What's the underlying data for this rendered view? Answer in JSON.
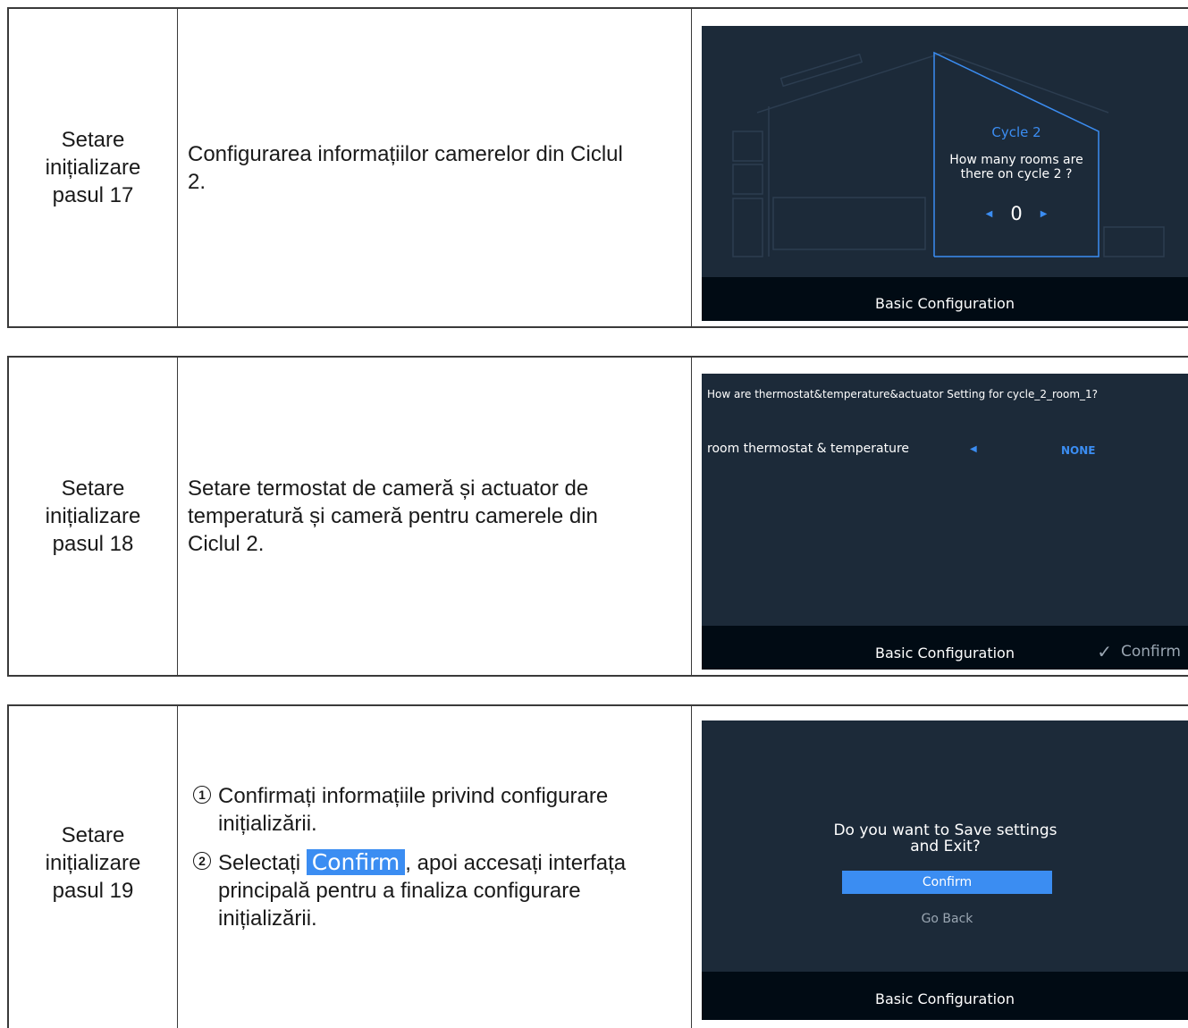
{
  "steps": [
    {
      "step_label": [
        "Setare",
        "inițializare",
        "pasul 17"
      ],
      "description": "Configurarea informațiilor camerelor din Ciclul 2.",
      "screen": {
        "cycle_title": "Cycle 2",
        "question": "How many rooms are there on cycle 2 ?",
        "value": "0",
        "footer": "Basic Configuration"
      }
    },
    {
      "step_label": [
        "Setare",
        "inițializare",
        "pasul 18"
      ],
      "description": "Setare termostat de cameră și actuator de temperatură și cameră pentru camerele din Ciclul 2.",
      "screen": {
        "question": "How are  thermostat&temperature&actuator Setting for cycle_2_room_1?",
        "row_label": "room thermostat & temperature",
        "row_value": "NONE",
        "footer": "Basic Configuration",
        "confirm": "Confirm"
      }
    },
    {
      "step_label": [
        "Setare",
        "inițializare",
        "pasul 19"
      ],
      "items": [
        {
          "num": "1",
          "text": "Confirmați informațiile privind configurare inițializării."
        },
        {
          "num": "2",
          "before": "Selectați",
          "chip": "Confirm",
          "after": ", apoi accesați interfața principală pentru a finaliza configurare inițializării."
        }
      ],
      "screen": {
        "question": "Do you want to Save settings and Exit?",
        "confirm": "Confirm",
        "go_back": "Go Back",
        "footer": "Basic Configuration"
      }
    }
  ],
  "colors": {
    "screen_bg": "#1c2a39",
    "bar_bg": "#010b14",
    "accent": "#3b8df2"
  }
}
